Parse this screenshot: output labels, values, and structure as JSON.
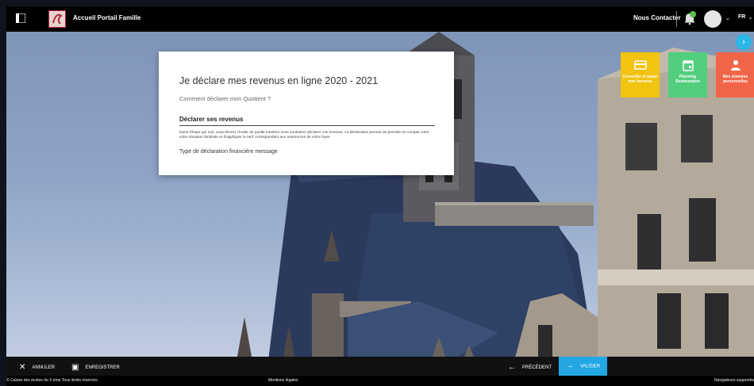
{
  "header": {
    "app_title": "Accueil Portail Famille",
    "contact_label": "Nous Contacter",
    "language": "FR",
    "icons": [
      "menu-icon",
      "logo",
      "bell-icon",
      "avatar",
      "chevron-down-icon"
    ]
  },
  "tiles": [
    {
      "label": "Consulter et payer mes factures",
      "color": "#f2c30f",
      "icon": "card-icon"
    },
    {
      "label": "Planning Restauration",
      "color": "#52cf7e",
      "icon": "calendar-icon"
    },
    {
      "label": "Mes données personnelles",
      "color": "#f06548",
      "icon": "person-icon"
    }
  ],
  "card": {
    "title": "Je déclare mes revenus en ligne 2020 - 2021",
    "help_link": "Comment déclarer mon Quotient ?",
    "section_title": "Déclarer ses revenus",
    "description": "Dans l'étape qui suit, vous devrez choisir de quelle manière vous souhaitez déclarer vos revenus. La déclaration permet de prendre en compte votre votre situation familiale et d'appliquer le tarif correspondant aux ressources de votre foyer.",
    "message": "Type de déclaration financière message"
  },
  "actions": {
    "cancel_label": "ANNULER",
    "save_label": "ENREGISTRER",
    "previous_label": "PRÉCÉDENT",
    "validate_label": "VALIDER"
  },
  "footer": {
    "copyright": "© Caisse des écoles du X ème.Tous droits réservés.",
    "legal": "Mentions légales",
    "browsers": "Navigateurs supportés"
  },
  "colors": {
    "accent": "#22a7e3",
    "topbar": "#000000",
    "actionbar": "#111111"
  }
}
